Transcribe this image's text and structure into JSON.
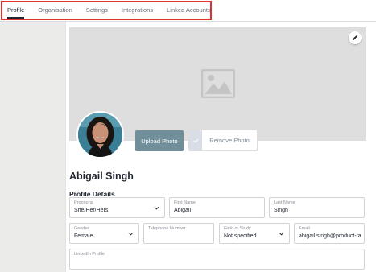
{
  "tabs": [
    {
      "label": "Profile",
      "active": true
    },
    {
      "label": "Organisation",
      "active": false
    },
    {
      "label": "Settings",
      "active": false
    },
    {
      "label": "Integrations",
      "active": false
    },
    {
      "label": "Linked Accounts",
      "active": false
    }
  ],
  "profile": {
    "upload_label": "Upload Photo",
    "remove_label": "Remove Photo",
    "name": "Abigail Singh",
    "section_title": "Profile Details"
  },
  "fields": {
    "pronouns": {
      "label": "Pronouns",
      "value": "She/Her/Hers"
    },
    "first_name": {
      "label": "First Name",
      "value": "Abigail"
    },
    "last_name": {
      "label": "Last Name",
      "value": "Singh"
    },
    "gender": {
      "label": "Gender",
      "value": "Female"
    },
    "telephone": {
      "label": "Telephone Number",
      "value": ""
    },
    "field_of_study": {
      "label": "Field of Study",
      "value": "Not specified"
    },
    "email": {
      "label": "Email",
      "value": "abigail.singh@product-fa"
    },
    "linkedin": {
      "label": "LinkedIn Profile",
      "value": ""
    }
  },
  "colors": {
    "accent_outline": "#e0322c",
    "upload_button": "#708f9a",
    "cover": "#dedede"
  },
  "icons": {
    "edit": "pencil-icon",
    "cover_placeholder": "image-placeholder-icon",
    "remove_check": "check-icon",
    "select": "chevron-down-icon"
  }
}
